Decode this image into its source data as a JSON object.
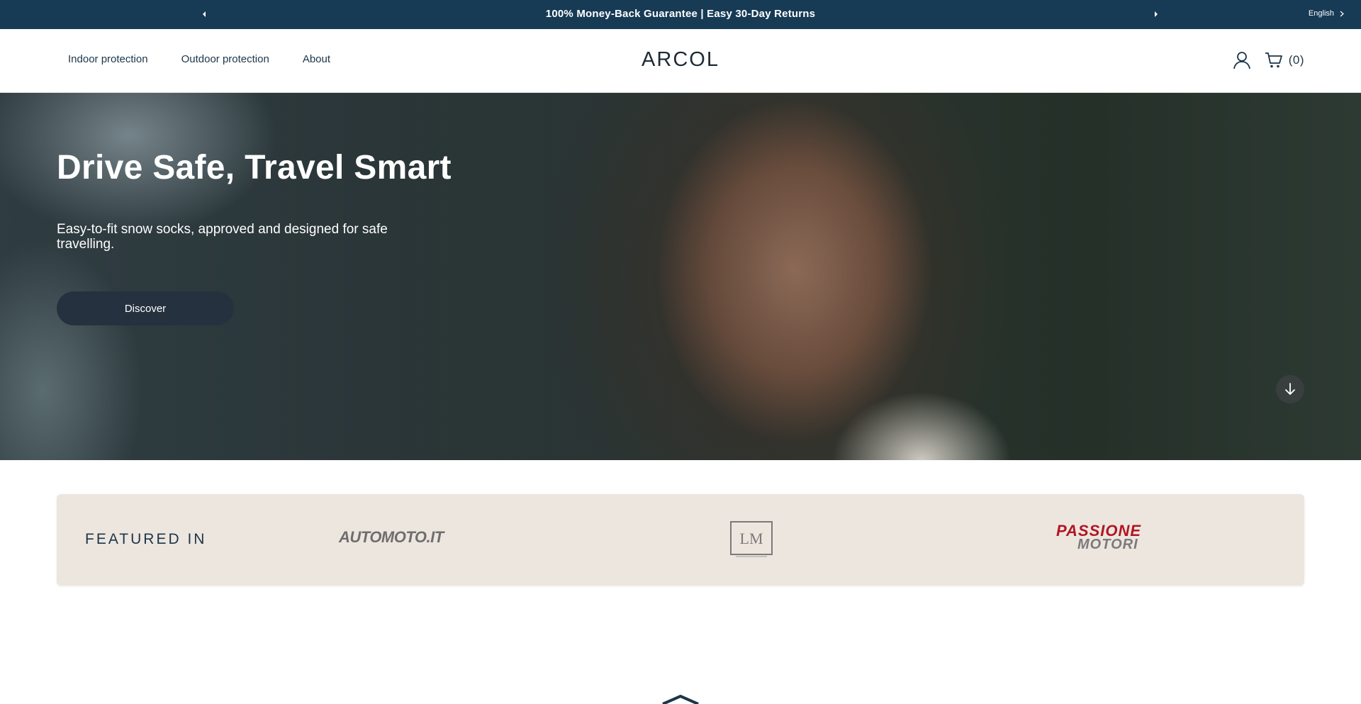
{
  "announcement": {
    "text": "100% Money-Back Guarantee | Easy 30-Day Returns",
    "language": "English"
  },
  "header": {
    "nav": [
      "Indoor protection",
      "Outdoor protection",
      "About"
    ],
    "logo": "ARCOL",
    "cart_count": "(0)"
  },
  "hero": {
    "title": "Drive Safe, Travel Smart",
    "subtitle": "Easy-to-fit snow socks, approved and designed for safe travelling.",
    "cta": "Discover"
  },
  "featured": {
    "label": "FEATURED IN",
    "logos": [
      "AUTOMOTO.IT",
      "LM",
      "PASSIONE",
      "MOTORI"
    ]
  },
  "colors": {
    "topbar": "#173a55",
    "text": "#1d3548",
    "button": "#25313f",
    "featured_bg": "#ede6df",
    "passione_red": "#b01622"
  }
}
